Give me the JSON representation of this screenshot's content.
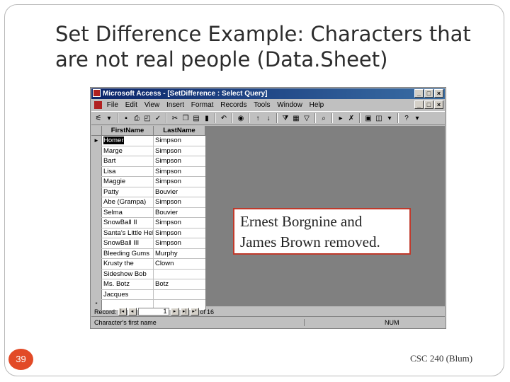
{
  "slide": {
    "title_line1": "Set Difference Example: Characters that",
    "title_line2": "are not real people (Data.Sheet)",
    "callout_line1": "Ernest Borgnine and",
    "callout_line2": "James Brown removed.",
    "page_number": "39",
    "footer": "CSC 240 (Blum)"
  },
  "window": {
    "title": "Microsoft Access - [SetDifference : Select Query]",
    "menu": [
      "File",
      "Edit",
      "View",
      "Insert",
      "Format",
      "Records",
      "Tools",
      "Window",
      "Help"
    ],
    "minimize": "_",
    "restore": "□",
    "close": "×"
  },
  "grid": {
    "headers": [
      "FirstName",
      "LastName"
    ],
    "rows": [
      [
        "Homer",
        "Simpson"
      ],
      [
        "Marge",
        "Simpson"
      ],
      [
        "Bart",
        "Simpson"
      ],
      [
        "Lisa",
        "Simpson"
      ],
      [
        "Maggie",
        "Simpson"
      ],
      [
        "Patty",
        "Bouvier"
      ],
      [
        "Abe (Grampa)",
        "Simpson"
      ],
      [
        "Selma",
        "Bouvier"
      ],
      [
        "SnowBall II",
        "Simpson"
      ],
      [
        "Santa's Little Helper",
        "Simpson"
      ],
      [
        "SnowBall III",
        "Simpson"
      ],
      [
        "Bleeding Gums",
        "Murphy"
      ],
      [
        "Krusty the",
        "Clown"
      ],
      [
        "Sideshow Bob",
        ""
      ],
      [
        "Ms. Botz",
        "Botz"
      ],
      [
        "Jacques",
        ""
      ]
    ],
    "new_row_marker": "*",
    "current_marker": "►"
  },
  "navigation": {
    "label": "Record:",
    "current": "1",
    "of_label": "of",
    "total": "16"
  },
  "status": {
    "text": "Character's first name",
    "num": "NUM"
  }
}
